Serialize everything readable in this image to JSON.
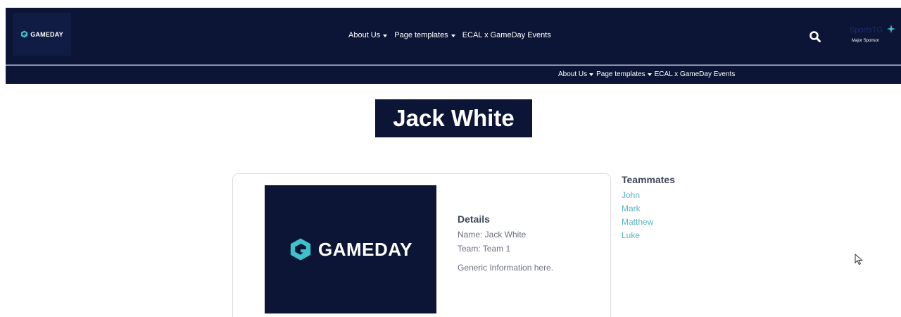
{
  "header": {
    "logo_text": "GAMEDAY",
    "nav": [
      {
        "label": "About Us",
        "has_dropdown": true
      },
      {
        "label": "Page templates",
        "has_dropdown": true
      },
      {
        "label": "ECAL x GameDay Events",
        "has_dropdown": false
      }
    ],
    "search_icon": "search-icon",
    "sponsor": {
      "logo_text": "SportsTG",
      "label": "Major Sponsor"
    }
  },
  "subnav": [
    {
      "label": "About Us",
      "has_dropdown": true
    },
    {
      "label": "Page templates",
      "has_dropdown": true
    },
    {
      "label": "ECAL x GameDay Events",
      "has_dropdown": false
    }
  ],
  "profile": {
    "title": "Jack White",
    "image_logo_text": "GAMEDAY",
    "details_heading": "Details",
    "name_line": "Name: Jack White",
    "team_line": "Team: Team 1",
    "info": "Generic Information here."
  },
  "teammates": {
    "heading": "Teammates",
    "items": [
      "John",
      "Mark",
      "Matthew",
      "Luke"
    ]
  },
  "colors": {
    "navy": "#0c1535",
    "accent_teal": "#5ab5c3",
    "logo_teal": "#3fc1c9"
  }
}
